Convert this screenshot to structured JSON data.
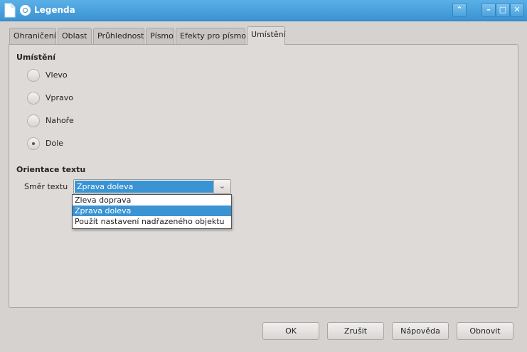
{
  "window": {
    "title": "Legenda",
    "controls": {
      "up": "⌃",
      "minimize": "–",
      "maximize": "□",
      "close": "✕"
    }
  },
  "tabs": [
    {
      "label": "Ohraničení"
    },
    {
      "label": "Oblast"
    },
    {
      "label": "Průhlednost"
    },
    {
      "label": "Písmo"
    },
    {
      "label": "Efekty pro písmo"
    },
    {
      "label": "Umístění"
    }
  ],
  "placement": {
    "heading": "Umístění",
    "options": [
      {
        "label": "Vlevo",
        "checked": false
      },
      {
        "label": "Vpravo",
        "checked": false
      },
      {
        "label": "Nahoře",
        "checked": false
      },
      {
        "label": "Dole",
        "checked": true
      }
    ]
  },
  "orientation": {
    "heading": "Orientace textu",
    "direction_label": "Směr textu",
    "selected": "Zprava doleva",
    "dropdown_arrow": "⌄",
    "options": [
      {
        "label": "Zleva doprava"
      },
      {
        "label": "Zprava doleva",
        "selected": true
      },
      {
        "label": "Použít nastavení nadřazeného objektu"
      }
    ]
  },
  "buttons": {
    "ok": "OK",
    "cancel": "Zrušit",
    "help": "Nápověda",
    "reset": "Obnovit"
  },
  "colors": {
    "titlebar": "#3a93d3",
    "selection": "#3a93d3",
    "background": "#d6d2d0"
  }
}
